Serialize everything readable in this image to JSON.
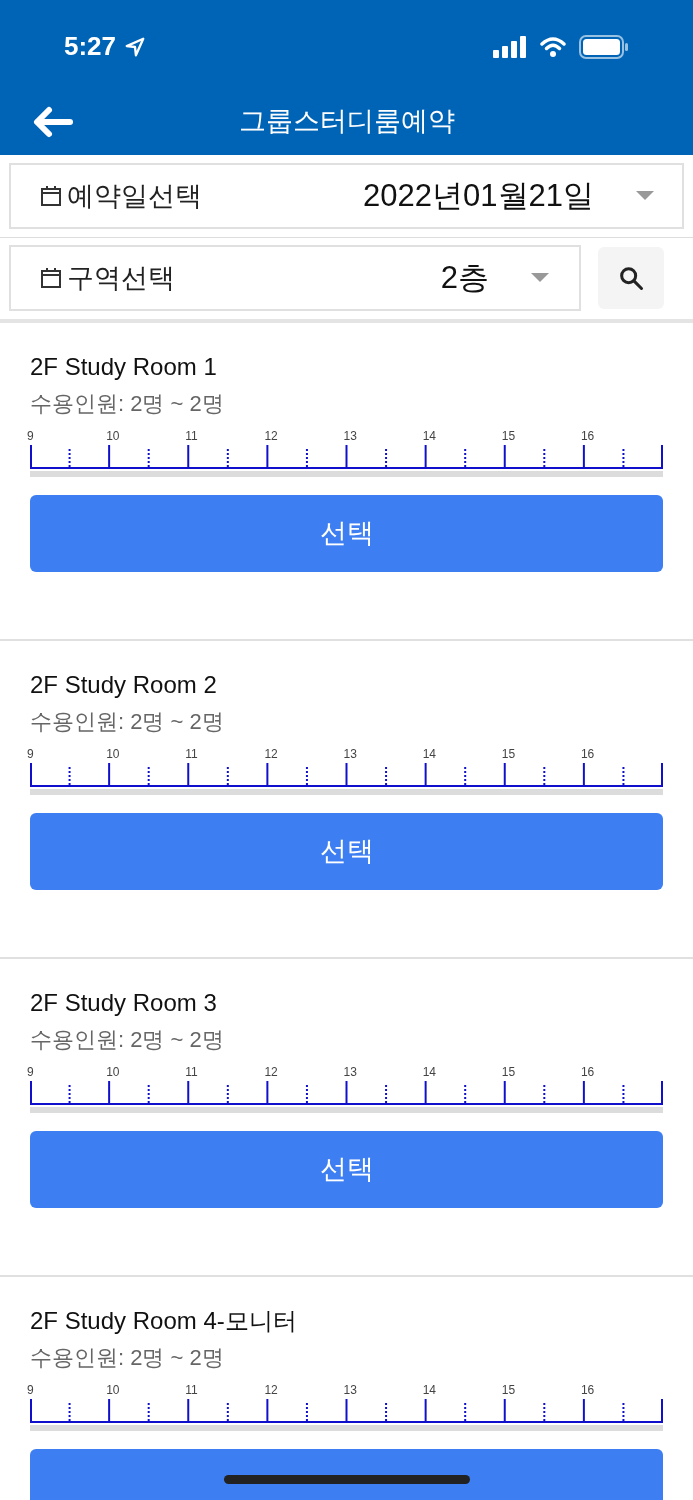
{
  "status_bar": {
    "time": "5:27"
  },
  "header": {
    "title": "그룹스터디룸예약"
  },
  "date_filter": {
    "label": "예약일선택",
    "value": "2022년01월21일"
  },
  "area_filter": {
    "label": "구역선택",
    "value": "2층"
  },
  "rooms": [
    {
      "name": "2F Study Room 1",
      "capacity": "수용인원: 2명 ~ 2명",
      "hours": [
        "9",
        "10",
        "11",
        "12",
        "13",
        "14",
        "15",
        "16"
      ],
      "button": "선택"
    },
    {
      "name": "2F Study Room 2",
      "capacity": "수용인원: 2명 ~ 2명",
      "hours": [
        "9",
        "10",
        "11",
        "12",
        "13",
        "14",
        "15",
        "16"
      ],
      "button": "선택"
    },
    {
      "name": "2F Study Room 3",
      "capacity": "수용인원: 2명 ~ 2명",
      "hours": [
        "9",
        "10",
        "11",
        "12",
        "13",
        "14",
        "15",
        "16"
      ],
      "button": "선택"
    },
    {
      "name": "2F Study Room 4-모니터",
      "capacity": "수용인원: 2명 ~ 2명",
      "hours": [
        "9",
        "10",
        "11",
        "12",
        "13",
        "14",
        "15",
        "16"
      ]
    }
  ]
}
